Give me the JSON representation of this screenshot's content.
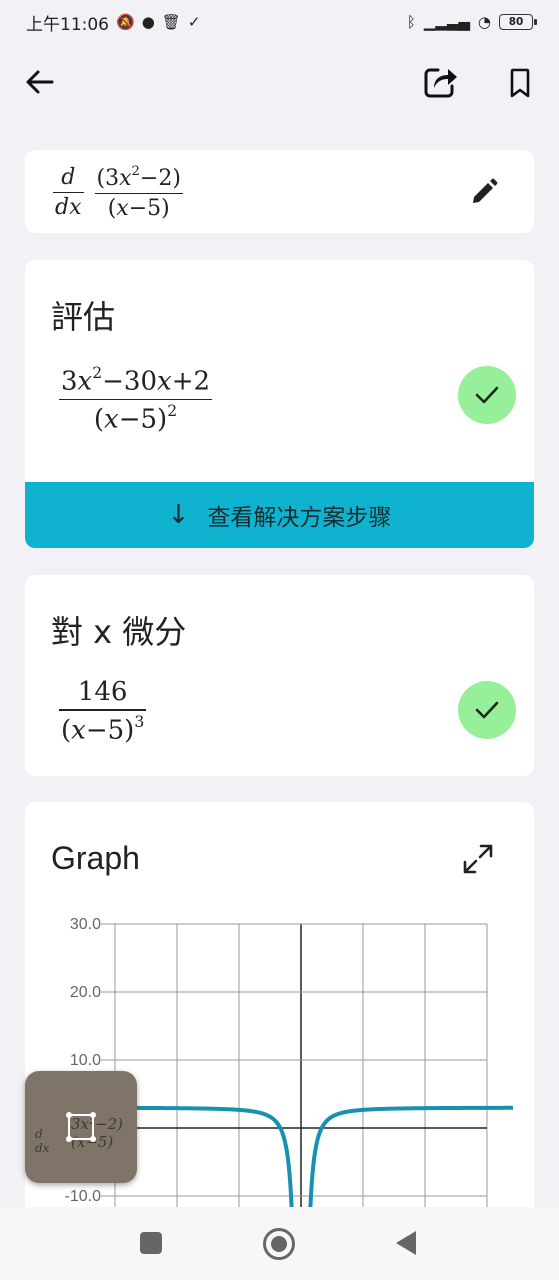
{
  "status_bar": {
    "time": "上午11:06",
    "battery": "80"
  },
  "input": {
    "d": "d",
    "dx": "dx",
    "numerator_a": "(3",
    "numerator_b": "x",
    "numerator_exp": "2",
    "numerator_c": "−2)",
    "denominator_a": "(",
    "denominator_b": "x",
    "denominator_c": "−5)"
  },
  "evaluate": {
    "title": "評估",
    "num_a": "3",
    "num_b": "x",
    "num_exp": "2",
    "num_c": "−30",
    "num_d": "x",
    "num_e": "+2",
    "den_a": "(",
    "den_b": "x",
    "den_c": "−5)",
    "den_exp": "2",
    "steps_label": "查看解决方案步骤"
  },
  "differentiate": {
    "title": "對 x 微分",
    "num": "146",
    "den_a": "(",
    "den_b": "x",
    "den_c": "−5)",
    "den_exp": "3"
  },
  "graph": {
    "title": "Graph"
  },
  "chart_data": {
    "type": "line",
    "y_tick_labels": [
      "30.0",
      "20.0",
      "10.0",
      "-10.0"
    ],
    "ylim": [
      -10,
      30
    ],
    "grid": true,
    "color": "#1890b0",
    "asymptote_x": 5,
    "horizontal_asymptote_y": 3
  },
  "colors": {
    "accent": "#10b3cf",
    "check": "#98ef9a",
    "curve": "#1890b0"
  }
}
